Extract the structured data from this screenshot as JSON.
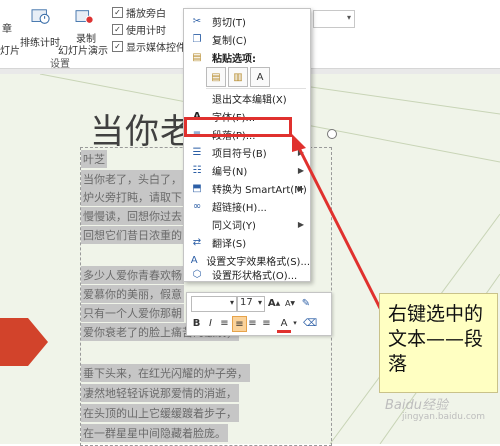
{
  "ribbon": {
    "partial_left_top": "章",
    "partial_left_bottom": "灯片",
    "rehearse_label": "排练计时",
    "record_label": "录制",
    "record_sub_label": "幻灯片演示",
    "checkboxes": [
      {
        "label": "播放旁白",
        "checked": true
      },
      {
        "label": "使用计时",
        "checked": true
      },
      {
        "label": "显示媒体控件",
        "checked": true
      }
    ],
    "group_label": "设置"
  },
  "slide": {
    "title": "当你老",
    "poem_lines": [
      "叶芝",
      "当你老了，头白了，",
      "炉火旁打盹，请取下",
      "慢慢读，回想你过去",
      "回想它们昔日浓重的",
      "",
      "多少人爱你青春欢畅",
      "爱慕你的美丽，假意",
      "只有一个人爱你那朝",
      "爱你衰老了的脸上痛苦的皱纹；",
      "",
      "垂下头来，在红光闪耀的炉子旁，",
      "凄然地轻轻诉说那爱情的消逝，",
      "在头顶的山上它缓缓踱着步子，",
      "在一群星星中间隐藏着脸庞。"
    ]
  },
  "context_menu": {
    "items": [
      {
        "icon": "cut-icon",
        "glyph": "✂",
        "label": "剪切(T)"
      },
      {
        "icon": "copy-icon",
        "glyph": "❐",
        "label": "复制(C)"
      },
      {
        "icon": "paste-options-icon",
        "glyph": "📋",
        "label": "粘贴选项:",
        "bold": true
      },
      {
        "icon": "none",
        "glyph": "",
        "label": "退出文本编辑(X)"
      },
      {
        "icon": "font-icon",
        "glyph": "A",
        "label": "字体(F)..."
      },
      {
        "icon": "paragraph-icon",
        "glyph": "≡",
        "label": "段落(P)..."
      },
      {
        "icon": "bullets-icon",
        "glyph": "☰",
        "label": "项目符号(B)",
        "submenu": true
      },
      {
        "icon": "numbering-icon",
        "glyph": "☷",
        "label": "编号(N)",
        "submenu": true
      },
      {
        "icon": "smartart-icon",
        "glyph": "⬒",
        "label": "转换为 SmartArt(M)",
        "submenu": true
      },
      {
        "icon": "hyperlink-icon",
        "glyph": "🔗",
        "label": "超链接(H)..."
      },
      {
        "icon": "none",
        "glyph": "",
        "label": "同义词(Y)",
        "submenu": true
      },
      {
        "icon": "translate-icon",
        "glyph": "⇄",
        "label": "翻译(S)"
      },
      {
        "icon": "text-effects-icon",
        "glyph": "A",
        "label": "设置文字效果格式(S)..."
      },
      {
        "icon": "shape-format-icon",
        "glyph": "⬡",
        "label": "设置形状格式(O)..."
      }
    ],
    "paste_buttons": [
      "paste-keep-source-icon",
      "paste-merge-icon",
      "paste-text-only-icon"
    ]
  },
  "mini_toolbar": {
    "font_name": "",
    "font_size": "17",
    "grow_font": "A",
    "shrink_font": "A",
    "bold": "B",
    "italic": "I",
    "font_color_label": "A"
  },
  "annotation": {
    "text": "右键选中的文本——段落"
  },
  "watermark": {
    "main": "Baidu经验",
    "sub": "jingyan.baidu.com"
  },
  "colors": {
    "highlight_red": "#e0312e",
    "note_yellow": "#ffffc2",
    "slide_bg": "#f0f4e9",
    "accent_shape": "#d2432b"
  }
}
